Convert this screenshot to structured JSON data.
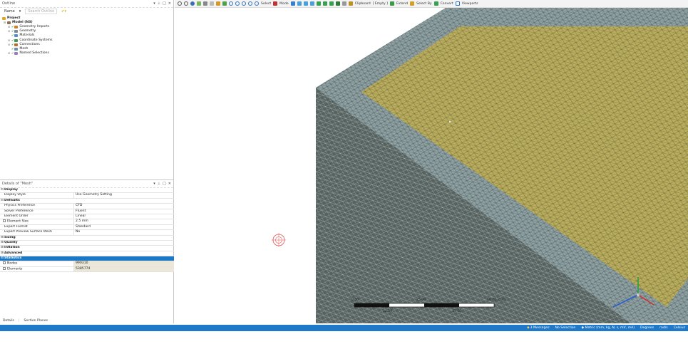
{
  "outline": {
    "title": "Outline",
    "name_label": "Name",
    "search_placeholder": "Search Outline",
    "tree": [
      {
        "label": "Project",
        "bold": true
      },
      {
        "label": "Model (N3)",
        "bold": true
      },
      {
        "label": "Geometry Imports"
      },
      {
        "label": "Geometry"
      },
      {
        "label": "Materials"
      },
      {
        "label": "Coordinate Systems"
      },
      {
        "label": "Connections"
      },
      {
        "label": "Mesh"
      },
      {
        "label": "Named Selections"
      }
    ]
  },
  "details": {
    "title": "Details of \"Mesh\"",
    "display_section": "Display",
    "display_style_key": "Display Style",
    "display_style_val": "Use Geometry Setting",
    "defaults_section": "Defaults",
    "physics_key": "Physics Preference",
    "physics_val": "CFD",
    "solver_key": "Solver Preference",
    "solver_val": "Fluent",
    "order_key": "Element Order",
    "order_val": "Linear",
    "size_key": "Element Size",
    "size_val": "2.5 mm",
    "export_key": "Export Format",
    "export_val": "Standard",
    "preview_key": "Export Preview Surface Mesh",
    "preview_val": "No",
    "sizing_section": "Sizing",
    "quality_section": "Quality",
    "inflation_section": "Inflation",
    "advanced_section": "Advanced",
    "statistics_section": "Statistics",
    "nodes_key": "Nodes",
    "nodes_val": "990310",
    "elements_key": "Elements",
    "elements_val": "5385774",
    "tab_details": "Details",
    "tab_section": "Section Planes"
  },
  "toolbar": {
    "select": "Select",
    "mode": "Mode",
    "clipboard": "Clipboard",
    "empty": "[ Empty ]",
    "extend": "Extend",
    "select_by": "Select By",
    "convert": "Convert",
    "viewports": "Viewports"
  },
  "scale": {
    "t0": "0.00",
    "t1": "25.00",
    "t2": "50.00 (mm)",
    "b1": "12.50",
    "b2": "37.50"
  },
  "status": {
    "messages": "3 Messages",
    "selection": "No Selection",
    "units": "Metric (mm, kg, N, s, mV, mA)",
    "degrees": "Degrees",
    "rads": "rad/s",
    "temp": "Celsius"
  },
  "colors": {
    "accent": "#1f78c8",
    "mesh_side": "#4f5f5c",
    "mesh_top": "#b9ac5c",
    "mesh_rim": "#8fa0a2"
  }
}
